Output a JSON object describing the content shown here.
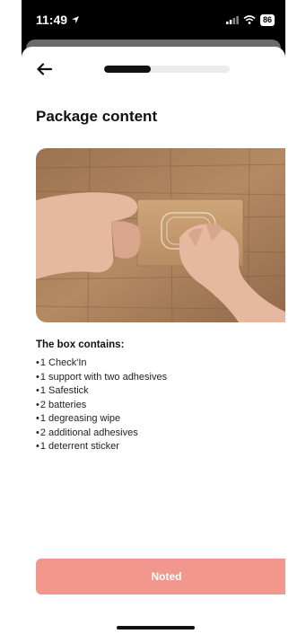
{
  "status_bar": {
    "time": "11:49",
    "battery": "86"
  },
  "progress": {
    "fraction": 0.37
  },
  "page": {
    "title": "Package content",
    "box_heading": "The box contains:",
    "items": [
      "1 Check'In",
      "1 support with two adhesives",
      "1 Safestick",
      "2 batteries",
      "1 degreasing wipe",
      "2 additional adhesives",
      "1 deterrent sticker"
    ]
  },
  "actions": {
    "noted_label": "Noted"
  },
  "icons": {
    "back": "arrow-left-icon",
    "location": "location-arrow-icon",
    "signal": "signal-icon",
    "wifi": "wifi-icon",
    "battery": "battery-icon"
  },
  "colors": {
    "button": "#f2978d",
    "progress_fill": "#111111",
    "progress_track": "#ececec"
  }
}
